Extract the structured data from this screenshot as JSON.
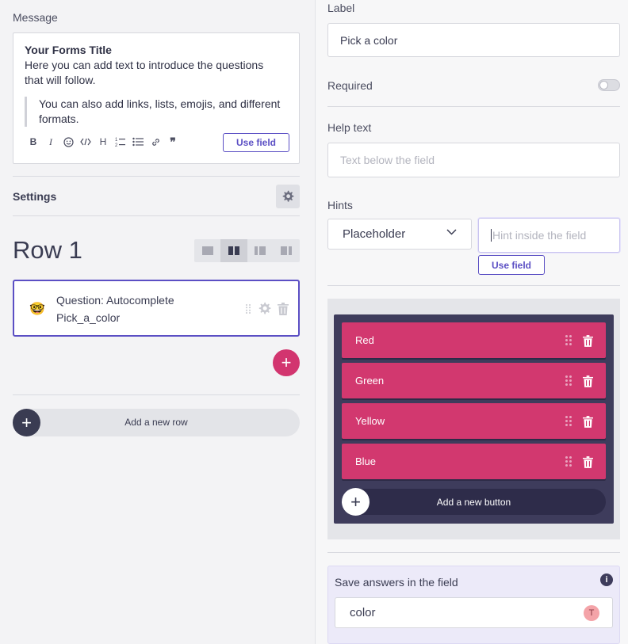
{
  "left": {
    "message_label": "Message",
    "message": {
      "title": "Your Forms Title",
      "line1": "Here you can add text to introduce the questions",
      "line2": "that will follow.",
      "quote_line1": "You can also add links, lists, emojis, and different",
      "quote_line2": "formats.",
      "use_field": "Use field",
      "toolbar": [
        "B",
        "I",
        "smile-icon",
        "code-icon",
        "H",
        "ordered-list-icon",
        "bullet-list-icon",
        "link-icon",
        "quote-icon"
      ]
    },
    "settings_label": "Settings",
    "row_title": "Row 1",
    "question": {
      "emoji": "🤓",
      "type": "Question: Autocomplete",
      "name": "Pick_a_color"
    },
    "add_row_label": "Add a new row"
  },
  "right": {
    "label_title": "Label",
    "label_value": "Pick a color",
    "required_label": "Required",
    "required_on": false,
    "help_title": "Help text",
    "help_placeholder": "Text below the field",
    "hints_title": "Hints",
    "hints_select": "Placeholder",
    "hint_placeholder": "Hint inside the field",
    "hint_use_field": "Use field",
    "choices": [
      "Red",
      "Green",
      "Yellow",
      "Blue"
    ],
    "add_button_label": "Add a new button",
    "save_label": "Save answers in the field",
    "save_value": "color",
    "avatar_letter": "T"
  },
  "colors": {
    "accent": "#5b4fc4",
    "pink": "#d2386f",
    "dark": "#3e3c5c"
  }
}
